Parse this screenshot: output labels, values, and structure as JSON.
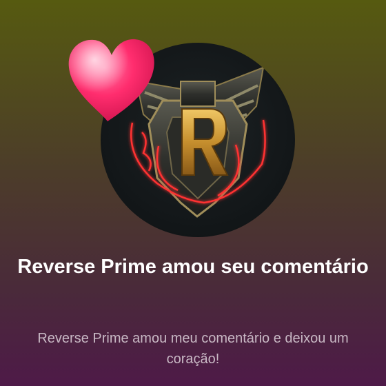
{
  "notification": {
    "title": "Reverse Prime amou seu comentário",
    "message": "Reverse Prime amou meu comentário e deixou um coração!"
  },
  "avatar": {
    "monogram": "R"
  },
  "icons": {
    "reaction": "heart-icon"
  },
  "colors": {
    "heart": "#ff2d6e",
    "gold": "#d3a23a",
    "glow": "#ff2a2a"
  }
}
